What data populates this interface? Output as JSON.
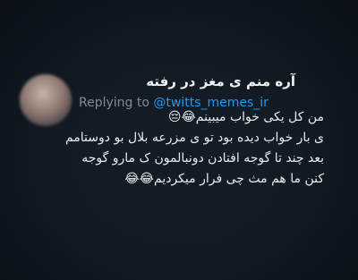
{
  "tweet": {
    "display_name": "آره منم ی مغز در رفته",
    "replying_prefix": "Replying to",
    "replying_handle": "@twitts_memes_ir",
    "lines": [
      "من کل یکی خواب میبینم😂😔",
      "ی بار خواب دیده بود تو ی مزرعه بلال بو دوستامم",
      "بعد چند تا گوجه افتادن دونبالمون ک مارو گوجه",
      "کنن ما هم مث چی فرار میکردیم😂😂"
    ]
  },
  "colors": {
    "background": "#131b24",
    "handle": "#1d9bf0",
    "secondary_text": "#7d8c99",
    "primary_text": "#e9ecef"
  }
}
